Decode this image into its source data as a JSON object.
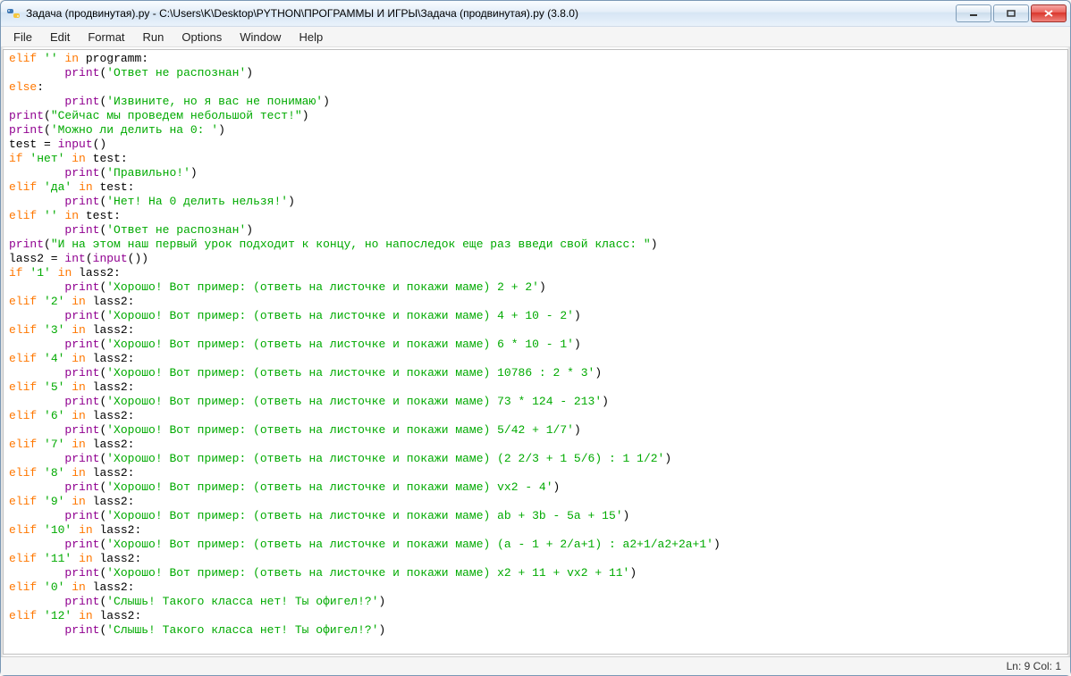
{
  "window": {
    "title": "Задача (продвинутая).py - C:\\Users\\K\\Desktop\\PYTHON\\ПРОГРАММЫ И ИГРЫ\\Задача (продвинутая).py (3.8.0)"
  },
  "menu": {
    "file": "File",
    "edit": "Edit",
    "format": "Format",
    "run": "Run",
    "options": "Options",
    "window": "Window",
    "help": "Help"
  },
  "status": {
    "position": "Ln: 9  Col: 1"
  },
  "code": [
    [
      [
        "kw",
        "elif"
      ],
      [
        "txt",
        " "
      ],
      [
        "str",
        "''"
      ],
      [
        "txt",
        " "
      ],
      [
        "kw",
        "in"
      ],
      [
        "txt",
        " programm:"
      ]
    ],
    [
      [
        "txt",
        "        "
      ],
      [
        "bi",
        "print"
      ],
      [
        "txt",
        "("
      ],
      [
        "str",
        "'Ответ не распознан'"
      ],
      [
        "txt",
        ")"
      ]
    ],
    [
      [
        "kw",
        "else"
      ],
      [
        "txt",
        ":"
      ]
    ],
    [
      [
        "txt",
        "        "
      ],
      [
        "bi",
        "print"
      ],
      [
        "txt",
        "("
      ],
      [
        "str",
        "'Извините, но я вас не понимаю'"
      ],
      [
        "txt",
        ")"
      ]
    ],
    [
      [
        "bi",
        "print"
      ],
      [
        "txt",
        "("
      ],
      [
        "str",
        "\"Сейчас мы проведем небольшой тест!\""
      ],
      [
        "txt",
        ")"
      ]
    ],
    [
      [
        "bi",
        "print"
      ],
      [
        "txt",
        "("
      ],
      [
        "str",
        "'Можно ли делить на 0: '"
      ],
      [
        "txt",
        ")"
      ]
    ],
    [
      [
        "txt",
        "test = "
      ],
      [
        "bi",
        "input"
      ],
      [
        "txt",
        "()"
      ]
    ],
    [
      [
        "kw",
        "if"
      ],
      [
        "txt",
        " "
      ],
      [
        "str",
        "'нет'"
      ],
      [
        "txt",
        " "
      ],
      [
        "kw",
        "in"
      ],
      [
        "txt",
        " test:"
      ]
    ],
    [
      [
        "txt",
        "        "
      ],
      [
        "bi",
        "print"
      ],
      [
        "txt",
        "("
      ],
      [
        "str",
        "'Правильно!'"
      ],
      [
        "txt",
        ")"
      ]
    ],
    [
      [
        "kw",
        "elif"
      ],
      [
        "txt",
        " "
      ],
      [
        "str",
        "'да'"
      ],
      [
        "txt",
        " "
      ],
      [
        "kw",
        "in"
      ],
      [
        "txt",
        " test:"
      ]
    ],
    [
      [
        "txt",
        "        "
      ],
      [
        "bi",
        "print"
      ],
      [
        "txt",
        "("
      ],
      [
        "str",
        "'Нет! На 0 делить нельзя!'"
      ],
      [
        "txt",
        ")"
      ]
    ],
    [
      [
        "kw",
        "elif"
      ],
      [
        "txt",
        " "
      ],
      [
        "str",
        "''"
      ],
      [
        "txt",
        " "
      ],
      [
        "kw",
        "in"
      ],
      [
        "txt",
        " test:"
      ]
    ],
    [
      [
        "txt",
        "        "
      ],
      [
        "bi",
        "print"
      ],
      [
        "txt",
        "("
      ],
      [
        "str",
        "'Ответ не распознан'"
      ],
      [
        "txt",
        ")"
      ]
    ],
    [
      [
        "bi",
        "print"
      ],
      [
        "txt",
        "("
      ],
      [
        "str",
        "\"И на этом наш первый урок подходит к концу, но напоследок еще раз введи свой класс: \""
      ],
      [
        "txt",
        ")"
      ]
    ],
    [
      [
        "txt",
        "lass2 = "
      ],
      [
        "bi",
        "int"
      ],
      [
        "txt",
        "("
      ],
      [
        "bi",
        "input"
      ],
      [
        "txt",
        "())"
      ]
    ],
    [
      [
        "kw",
        "if"
      ],
      [
        "txt",
        " "
      ],
      [
        "str",
        "'1'"
      ],
      [
        "txt",
        " "
      ],
      [
        "kw",
        "in"
      ],
      [
        "txt",
        " lass2:"
      ]
    ],
    [
      [
        "txt",
        "        "
      ],
      [
        "bi",
        "print"
      ],
      [
        "txt",
        "("
      ],
      [
        "str",
        "'Хорошо! Вот пример: (ответь на листочке и покажи маме) 2 + 2'"
      ],
      [
        "txt",
        ")"
      ]
    ],
    [
      [
        "kw",
        "elif"
      ],
      [
        "txt",
        " "
      ],
      [
        "str",
        "'2'"
      ],
      [
        "txt",
        " "
      ],
      [
        "kw",
        "in"
      ],
      [
        "txt",
        " lass2:"
      ]
    ],
    [
      [
        "txt",
        "        "
      ],
      [
        "bi",
        "print"
      ],
      [
        "txt",
        "("
      ],
      [
        "str",
        "'Хорошо! Вот пример: (ответь на листочке и покажи маме) 4 + 10 - 2'"
      ],
      [
        "txt",
        ")"
      ]
    ],
    [
      [
        "kw",
        "elif"
      ],
      [
        "txt",
        " "
      ],
      [
        "str",
        "'3'"
      ],
      [
        "txt",
        " "
      ],
      [
        "kw",
        "in"
      ],
      [
        "txt",
        " lass2:"
      ]
    ],
    [
      [
        "txt",
        "        "
      ],
      [
        "bi",
        "print"
      ],
      [
        "txt",
        "("
      ],
      [
        "str",
        "'Хорошо! Вот пример: (ответь на листочке и покажи маме) 6 * 10 - 1'"
      ],
      [
        "txt",
        ")"
      ]
    ],
    [
      [
        "kw",
        "elif"
      ],
      [
        "txt",
        " "
      ],
      [
        "str",
        "'4'"
      ],
      [
        "txt",
        " "
      ],
      [
        "kw",
        "in"
      ],
      [
        "txt",
        " lass2:"
      ]
    ],
    [
      [
        "txt",
        "        "
      ],
      [
        "bi",
        "print"
      ],
      [
        "txt",
        "("
      ],
      [
        "str",
        "'Хорошо! Вот пример: (ответь на листочке и покажи маме) 10786 : 2 * 3'"
      ],
      [
        "txt",
        ")"
      ]
    ],
    [
      [
        "kw",
        "elif"
      ],
      [
        "txt",
        " "
      ],
      [
        "str",
        "'5'"
      ],
      [
        "txt",
        " "
      ],
      [
        "kw",
        "in"
      ],
      [
        "txt",
        " lass2:"
      ]
    ],
    [
      [
        "txt",
        "        "
      ],
      [
        "bi",
        "print"
      ],
      [
        "txt",
        "("
      ],
      [
        "str",
        "'Хорошо! Вот пример: (ответь на листочке и покажи маме) 73 * 124 - 213'"
      ],
      [
        "txt",
        ")"
      ]
    ],
    [
      [
        "kw",
        "elif"
      ],
      [
        "txt",
        " "
      ],
      [
        "str",
        "'6'"
      ],
      [
        "txt",
        " "
      ],
      [
        "kw",
        "in"
      ],
      [
        "txt",
        " lass2:"
      ]
    ],
    [
      [
        "txt",
        "        "
      ],
      [
        "bi",
        "print"
      ],
      [
        "txt",
        "("
      ],
      [
        "str",
        "'Хорошо! Вот пример: (ответь на листочке и покажи маме) 5/42 + 1/7'"
      ],
      [
        "txt",
        ")"
      ]
    ],
    [
      [
        "kw",
        "elif"
      ],
      [
        "txt",
        " "
      ],
      [
        "str",
        "'7'"
      ],
      [
        "txt",
        " "
      ],
      [
        "kw",
        "in"
      ],
      [
        "txt",
        " lass2:"
      ]
    ],
    [
      [
        "txt",
        "        "
      ],
      [
        "bi",
        "print"
      ],
      [
        "txt",
        "("
      ],
      [
        "str",
        "'Хорошо! Вот пример: (ответь на листочке и покажи маме) (2 2/3 + 1 5/6) : 1 1/2'"
      ],
      [
        "txt",
        ")"
      ]
    ],
    [
      [
        "kw",
        "elif"
      ],
      [
        "txt",
        " "
      ],
      [
        "str",
        "'8'"
      ],
      [
        "txt",
        " "
      ],
      [
        "kw",
        "in"
      ],
      [
        "txt",
        " lass2:"
      ]
    ],
    [
      [
        "txt",
        "        "
      ],
      [
        "bi",
        "print"
      ],
      [
        "txt",
        "("
      ],
      [
        "str",
        "'Хорошо! Вот пример: (ответь на листочке и покажи маме) vx2 - 4'"
      ],
      [
        "txt",
        ")"
      ]
    ],
    [
      [
        "kw",
        "elif"
      ],
      [
        "txt",
        " "
      ],
      [
        "str",
        "'9'"
      ],
      [
        "txt",
        " "
      ],
      [
        "kw",
        "in"
      ],
      [
        "txt",
        " lass2:"
      ]
    ],
    [
      [
        "txt",
        "        "
      ],
      [
        "bi",
        "print"
      ],
      [
        "txt",
        "("
      ],
      [
        "str",
        "'Хорошо! Вот пример: (ответь на листочке и покажи маме) ab + 3b - 5a + 15'"
      ],
      [
        "txt",
        ")"
      ]
    ],
    [
      [
        "kw",
        "elif"
      ],
      [
        "txt",
        " "
      ],
      [
        "str",
        "'10'"
      ],
      [
        "txt",
        " "
      ],
      [
        "kw",
        "in"
      ],
      [
        "txt",
        " lass2:"
      ]
    ],
    [
      [
        "txt",
        "        "
      ],
      [
        "bi",
        "print"
      ],
      [
        "txt",
        "("
      ],
      [
        "str",
        "'Хорошо! Вот пример: (ответь на листочке и покажи маме) (a - 1 + 2/a+1) : a2+1/a2+2a+1'"
      ],
      [
        "txt",
        ")"
      ]
    ],
    [
      [
        "kw",
        "elif"
      ],
      [
        "txt",
        " "
      ],
      [
        "str",
        "'11'"
      ],
      [
        "txt",
        " "
      ],
      [
        "kw",
        "in"
      ],
      [
        "txt",
        " lass2:"
      ]
    ],
    [
      [
        "txt",
        "        "
      ],
      [
        "bi",
        "print"
      ],
      [
        "txt",
        "("
      ],
      [
        "str",
        "'Хорошо! Вот пример: (ответь на листочке и покажи маме) x2 + 11 + vx2 + 11'"
      ],
      [
        "txt",
        ")"
      ]
    ],
    [
      [
        "kw",
        "elif"
      ],
      [
        "txt",
        " "
      ],
      [
        "str",
        "'0'"
      ],
      [
        "txt",
        " "
      ],
      [
        "kw",
        "in"
      ],
      [
        "txt",
        " lass2:"
      ]
    ],
    [
      [
        "txt",
        "        "
      ],
      [
        "bi",
        "print"
      ],
      [
        "txt",
        "("
      ],
      [
        "str",
        "'Слышь! Такого класса нет! Ты офигел!?'"
      ],
      [
        "txt",
        ")"
      ]
    ],
    [
      [
        "kw",
        "elif"
      ],
      [
        "txt",
        " "
      ],
      [
        "str",
        "'12'"
      ],
      [
        "txt",
        " "
      ],
      [
        "kw",
        "in"
      ],
      [
        "txt",
        " lass2:"
      ]
    ],
    [
      [
        "txt",
        "        "
      ],
      [
        "bi",
        "print"
      ],
      [
        "txt",
        "("
      ],
      [
        "str",
        "'Слышь! Такого класса нет! Ты офигел!?'"
      ],
      [
        "txt",
        ")"
      ]
    ]
  ]
}
